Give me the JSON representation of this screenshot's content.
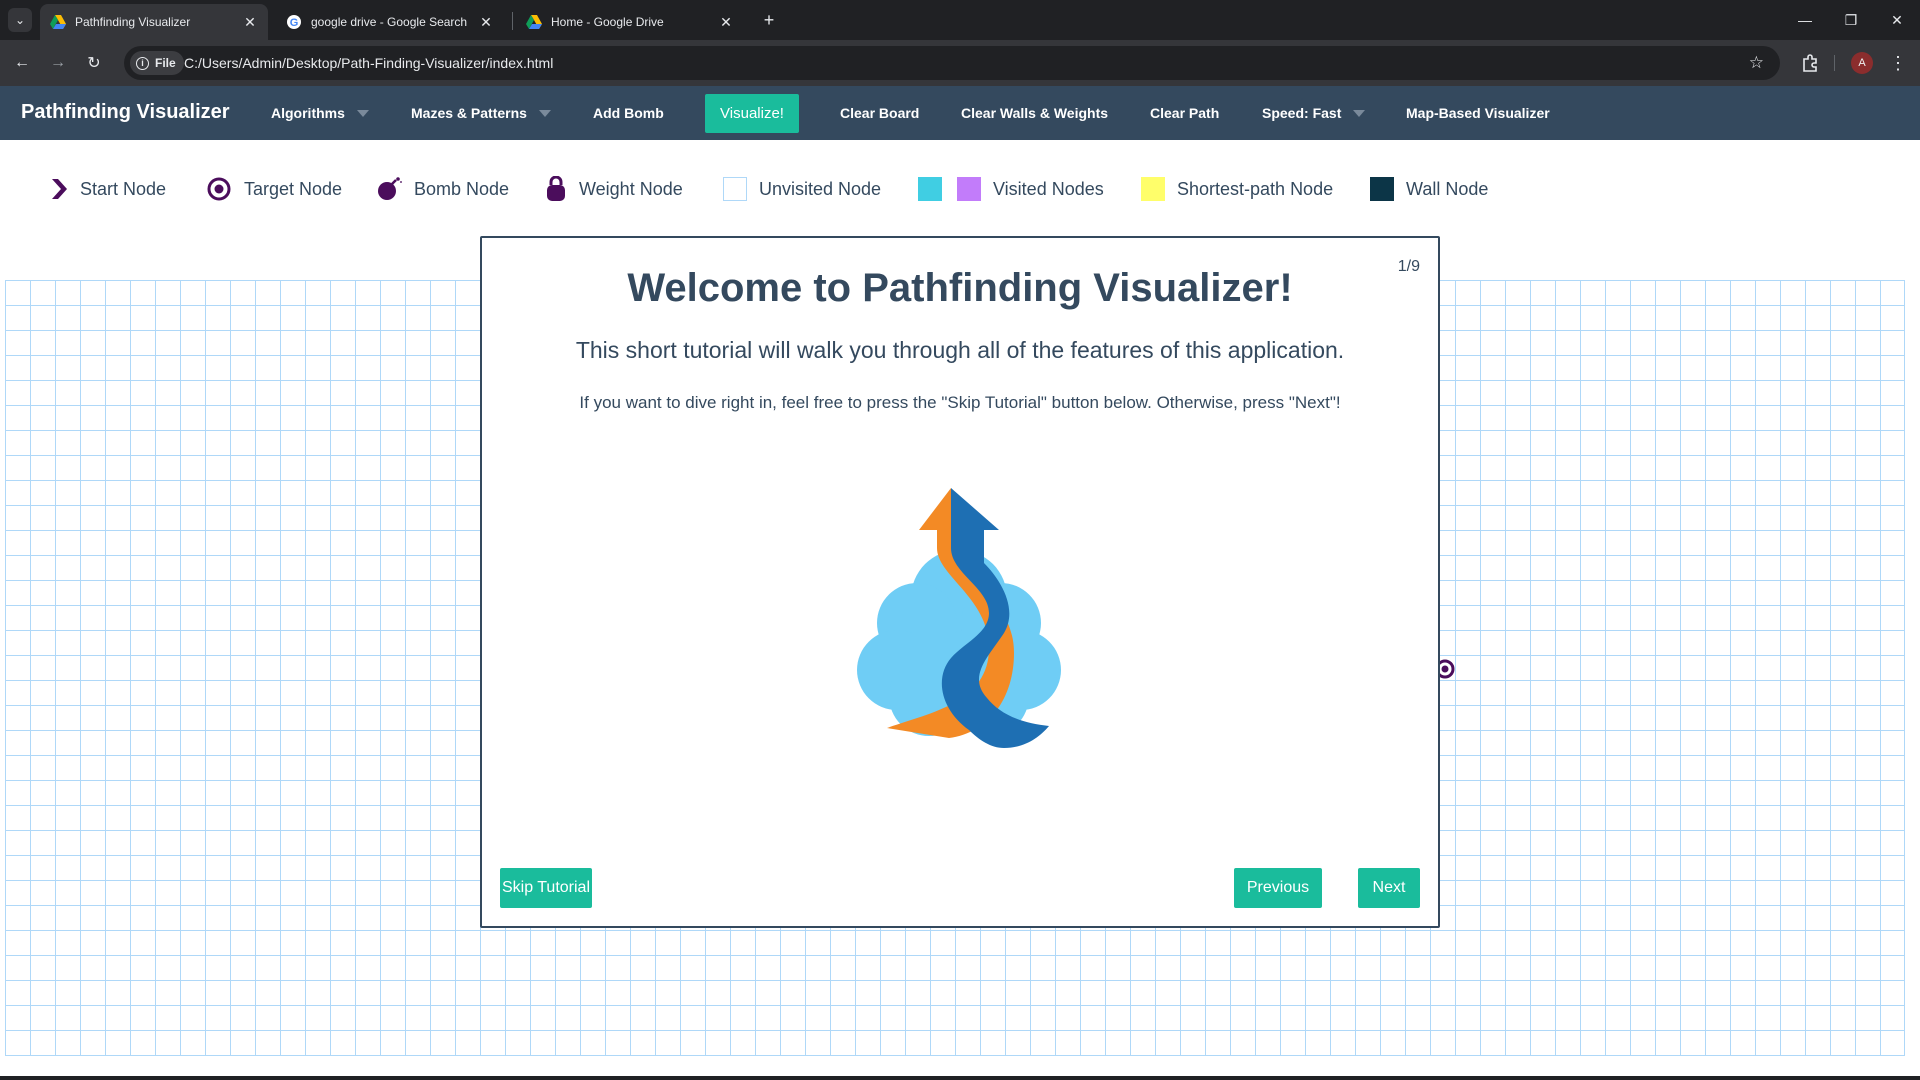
{
  "browser": {
    "tabs": [
      {
        "title": "Pathfinding Visualizer",
        "active": true,
        "icon": "drive-icon"
      },
      {
        "title": "google drive - Google Search",
        "active": false,
        "icon": "google-icon"
      },
      {
        "title": "Home - Google Drive",
        "active": false,
        "icon": "drive-icon"
      }
    ],
    "address_chip": "File",
    "url": "C:/Users/Admin/Desktop/Path-Finding-Visualizer/index.html",
    "profile_initial": "A"
  },
  "navbar": {
    "brand": "Pathfinding Visualizer",
    "algorithms": "Algorithms",
    "mazes": "Mazes & Patterns",
    "add_bomb": "Add Bomb",
    "visualize": "Visualize!",
    "clear_board": "Clear Board",
    "clear_walls": "Clear Walls & Weights",
    "clear_path": "Clear Path",
    "speed": "Speed: Fast",
    "map_visualizer": "Map-Based Visualizer"
  },
  "legend": {
    "start": "Start Node",
    "target": "Target Node",
    "bomb": "Bomb Node",
    "weight": "Weight Node",
    "unvisited": "Unvisited Node",
    "visited": "Visited Nodes",
    "shortest": "Shortest-path Node",
    "wall": "Wall Node"
  },
  "colors": {
    "navbar": "#34495e",
    "accent": "#1abc9c",
    "visited_a": "#40cee3",
    "visited_b": "#c27cfa",
    "shortest": "#fffe6a",
    "wall": "#0c3547",
    "node_icon": "#4b0d5c",
    "grid_line": "#afd8f8"
  },
  "tutorial": {
    "counter": "1/9",
    "title": "Welcome to Pathfinding Visualizer!",
    "subtitle": "This short tutorial will walk you through all of the features of this application.",
    "description": "If you want to dive right in, feel free to press the \"Skip Tutorial\" button below. Otherwise, press \"Next\"!",
    "skip": "Skip Tutorial",
    "previous": "Previous",
    "next": "Next"
  }
}
